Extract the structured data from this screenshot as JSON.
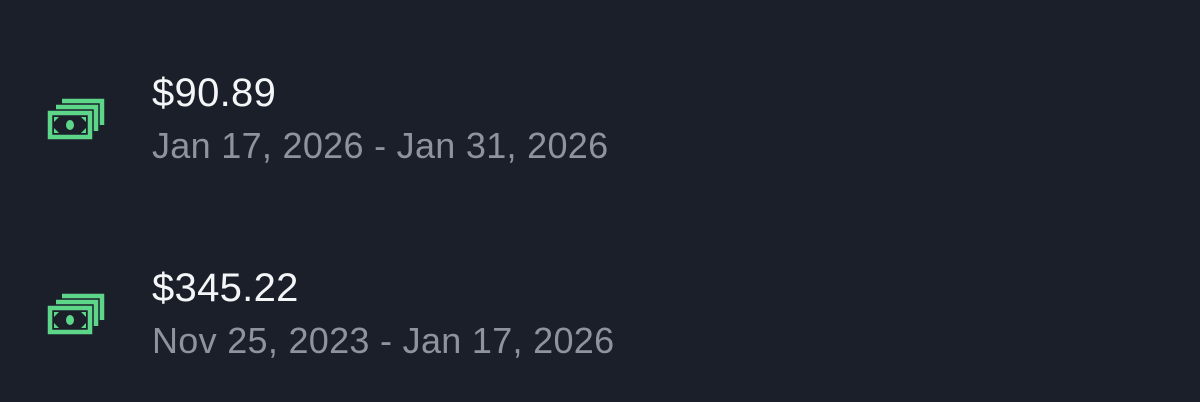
{
  "accent_color": "#5ed68a",
  "payouts": [
    {
      "icon": "money-bills-icon",
      "amount": "$90.89",
      "date_range": "Jan 17, 2026 - Jan 31, 2026"
    },
    {
      "icon": "money-bills-icon",
      "amount": "$345.22",
      "date_range": "Nov 25, 2023 - Jan 17, 2026"
    }
  ]
}
